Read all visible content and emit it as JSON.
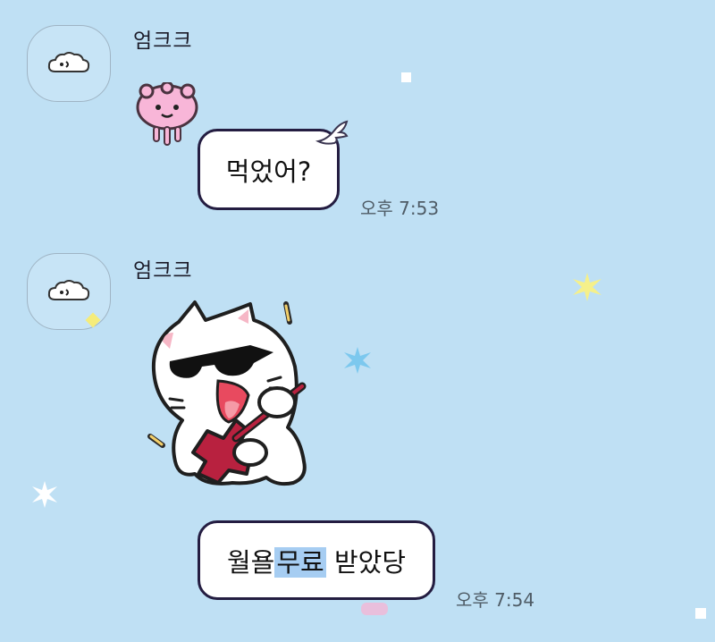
{
  "chat": {
    "messages": [
      {
        "sender": "엄크크",
        "text": "먹었어?",
        "time": "오후 7:53"
      },
      {
        "sender": "엄크크",
        "text_parts": [
          "월욜",
          "무료",
          " 받았당"
        ],
        "time": "오후 7:54"
      }
    ]
  },
  "icons": {
    "avatar": "cloud-face-icon",
    "sticker_small": "pink-jellyfish-sticker",
    "bubble_deco": "wing-icon",
    "sticker_large": "cat-guitar-sunglasses-sticker"
  },
  "colors": {
    "background": "#bfe0f4",
    "bubble_border": "#241d41",
    "highlight": "#a6cdf2",
    "time_text": "#4f5c66"
  }
}
